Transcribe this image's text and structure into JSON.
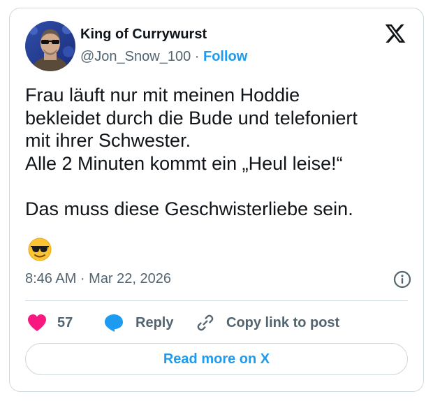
{
  "tweet": {
    "author": {
      "name": "King of Currywurst",
      "handle": "@Jon_Snow_100",
      "separator": " · ",
      "follow_label": "Follow",
      "avatar_icon": "profile-photo-avatar"
    },
    "platform_icon": "x-logo-icon",
    "text_lines": [
      "Frau läuft nur mit meinen Hoddie",
      "bekleidet durch die Bude und telefoniert",
      "mit ihrer  Schwester.",
      "Alle 2 Minuten kommt ein „Heul leise!“",
      "",
      "Das muss diese Geschwisterliebe sein."
    ],
    "emoji_icon": "smiling-face-with-sunglasses",
    "timestamp": "8:46 AM · Mar 22, 2026",
    "actions": {
      "like_count": "57",
      "reply_label": "Reply",
      "copy_label": "Copy link to post"
    },
    "read_more_label": "Read more on X"
  },
  "colors": {
    "accent": "#1d9bf0",
    "like": "#f91880",
    "text": "#0f1419",
    "secondary": "#536471",
    "border": "#cfd9de"
  }
}
